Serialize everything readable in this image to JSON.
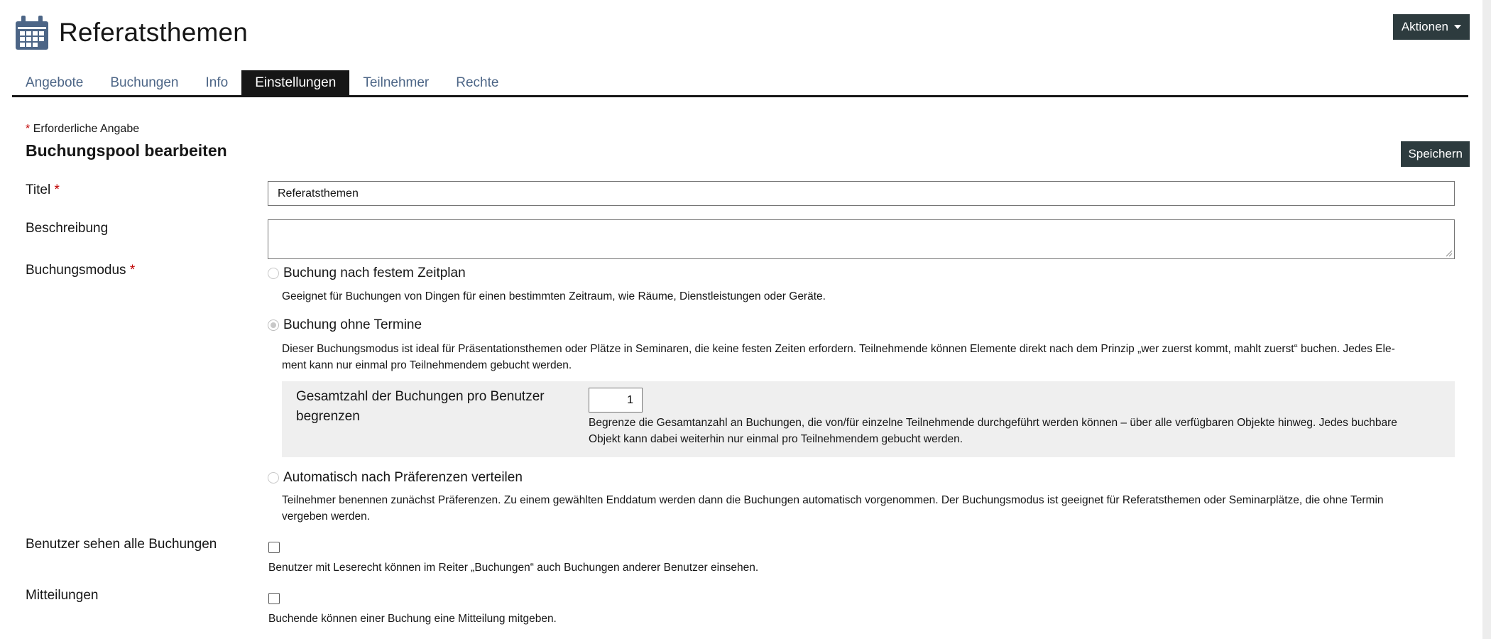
{
  "header": {
    "title": "Referatsthemen",
    "icon": "calendar-icon",
    "actions_label": "Aktionen"
  },
  "tabs": [
    {
      "label": "Angebote"
    },
    {
      "label": "Buchungen"
    },
    {
      "label": "Info"
    },
    {
      "label": "Einstellungen",
      "active": true
    },
    {
      "label": "Teilnehmer"
    },
    {
      "label": "Rechte"
    }
  ],
  "form": {
    "required_star": "*",
    "required_note": "Erforderliche Angabe",
    "title": "Buchungspool bearbeiten",
    "save_label": "Speichern",
    "fields": {
      "titel": {
        "label": "Titel",
        "value": "Referatsthemen"
      },
      "beschreibung": {
        "label": "Beschreibung",
        "value": ""
      },
      "buchungsmodus": {
        "label": "Buchungsmodus",
        "options": [
          {
            "label": "Buchung nach festem Zeitplan",
            "help": "Geeignet für Buchungen von Dingen für einen bestimmten Zeitraum, wie Räume, Dienstleistungen oder Geräte.",
            "checked": false
          },
          {
            "label": "Buchung ohne Termine",
            "help_line1": "Dieser Buchungsmodus ist ideal für Präsentationsthemen oder Plätze in Seminaren, die keine festen Zeiten erfordern. Teilnehmende können Elemente direkt nach dem Prinzip „wer zuerst kommt, mahlt zuerst“ buchen. Jedes Ele-",
            "help_line2": "ment kann nur einmal pro Teilnehmendem gebucht werden.",
            "checked": true
          },
          {
            "label": "Automatisch nach Präferenzen verteilen",
            "help_line1": "Teilnehmer benennen zunächst Präferenzen. Zu einem gewählten Enddatum werden dann die Buchungen automatisch vorgenommen. Der Buchungsmodus ist geeignet für Referatsthemen oder Seminarplätze, die ohne Termin",
            "help_line2": "vergeben werden.",
            "checked": false
          }
        ]
      },
      "limit": {
        "label_line1": "Gesamtzahl der Buchungen pro Benutzer",
        "label_line2": "begrenzen",
        "value": "1",
        "help_line1": "Begrenze die Gesamtanzahl an Buchungen, die von/für einzelne Teilnehmende durchgeführt werden können – über alle verfügbaren Objekte hinweg. Jedes buchbare",
        "help_line2": "Objekt kann dabei weiterhin nur einmal pro Teilnehmendem gebucht werden."
      },
      "benutzer_sehen": {
        "label": "Benutzer sehen alle Buchungen",
        "help": "Benutzer mit Leserecht können im Reiter „Buchungen“ auch Buchungen anderer Benutzer einsehen.",
        "checked": false
      },
      "mitteilungen": {
        "label": "Mitteilungen",
        "help": "Buchende können einer Buchung eine Mitteilung mitgeben.",
        "checked": false
      }
    }
  },
  "colors": {
    "accent_dark": "#2d3b3e",
    "tab_link": "#4c6586",
    "required": "#c00000",
    "icon": "#4c6586"
  }
}
